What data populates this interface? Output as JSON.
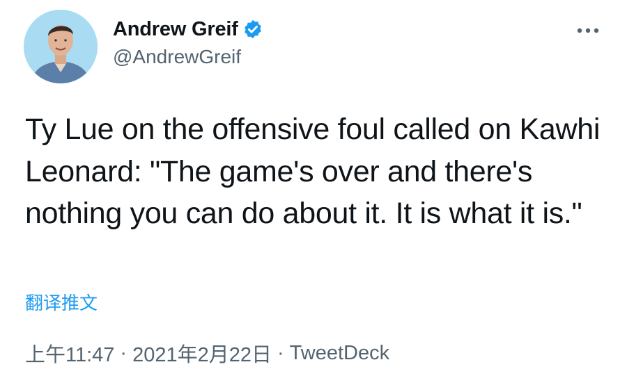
{
  "author": {
    "display_name": "Andrew Greif",
    "handle": "@AndrewGreif",
    "verified": true,
    "avatar_icon": "profile-photo"
  },
  "tweet": {
    "text": "Ty Lue on the offensive foul called on Kawhi Leonard: \"The game's over and there's nothing you can do about it. It is what it is.\"",
    "translate_label": "翻译推文",
    "time": "上午11:47",
    "separator": "·",
    "date": "2021年2月22日",
    "source": "TweetDeck"
  },
  "colors": {
    "text": "#0f1419",
    "secondary": "#536471",
    "accent": "#1d9bf0",
    "background": "#ffffff"
  },
  "icons": {
    "verified": "verified-badge-icon",
    "more": "more-options-icon"
  }
}
